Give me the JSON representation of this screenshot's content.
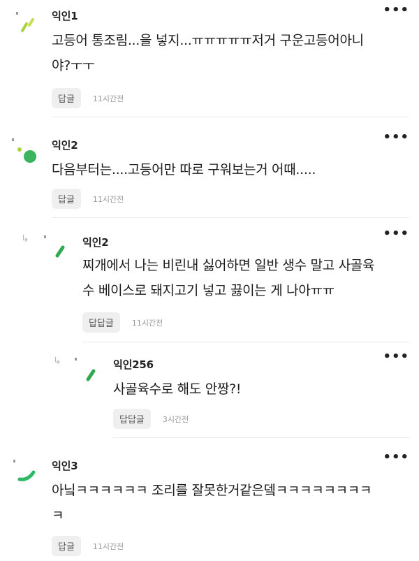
{
  "comments": [
    {
      "author": "익인1",
      "lines": [
        "고등어 통조림...을 넣지...ㅠㅠㅠㅠㅠ저거 구운고등어아니",
        "야?ㅜㅜ"
      ],
      "reply_label": "답글",
      "time": "11시간전",
      "more": "•••",
      "avatar_color": "#a8d43a"
    },
    {
      "author": "익인2",
      "lines": [
        "다음부터는....고등어만 따로 구워보는거 어때....."
      ],
      "reply_label": "답글",
      "time": "11시간전",
      "more": "•••",
      "avatar_color": "#3cb35e"
    },
    {
      "author": "익인2",
      "lines": [
        "찌개에서 나는 비린내 싫어하면 일반 생수 말고 사골육",
        "수 베이스로 돼지고기 넣고 끓이는 게 나아ㅠㅠ"
      ],
      "reply_label": "답답글",
      "time": "11시간전",
      "more": "•••",
      "avatar_color": "#2fa84f"
    },
    {
      "author": "익인256",
      "lines": [
        "사골육수로 해도 안짱?!"
      ],
      "reply_label": "답답글",
      "time": "3시간전",
      "more": "•••",
      "avatar_color": "#2fa84f"
    },
    {
      "author": "익인3",
      "lines": [
        "아닠ㅋㅋㅋㅋㅋㅋ 조리를 잘못한거같은뎈ㅋㅋㅋㅋㅋㅋㅋㅋ",
        "ㅋ"
      ],
      "reply_label": "답글",
      "time": "11시간전",
      "more": "•••",
      "avatar_color": "#2fb866"
    }
  ],
  "icons": {
    "reply_arrow": "reply-arrow-icon",
    "more": "more-options-icon"
  }
}
